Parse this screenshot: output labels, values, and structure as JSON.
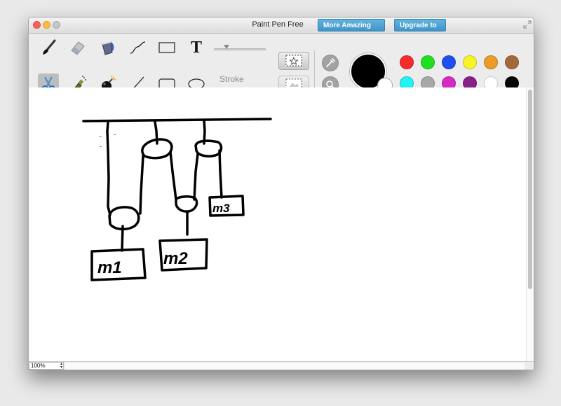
{
  "window": {
    "title": "Paint Pen Free",
    "more_apps_label": "More Amazing Apps",
    "upgrade_label": "Upgrade to Pro"
  },
  "toolbar": {
    "tools_row1": [
      "brush-icon",
      "eraser-icon",
      "paint-bucket-icon",
      "curve-icon",
      "rectangle-icon",
      "text-icon"
    ],
    "tools_row2": [
      "scissors-icon",
      "spray-icon",
      "bomb-icon",
      "line-icon",
      "rounded-rectangle-icon",
      "ellipse-icon"
    ],
    "selected_tool": "scissors-icon",
    "text_tool_glyph": "T",
    "stroke_label": "Stroke",
    "stroke_value": 0.2
  },
  "colors": {
    "current": "#000000",
    "background": "#ffffff",
    "palette_row1": [
      "#f52a2a",
      "#1fe01f",
      "#1f4ef0",
      "#f8f32b",
      "#ec9a2a",
      "#a4693a"
    ],
    "palette_row2": [
      "#22f3f3",
      "#a8a8a8",
      "#d42bc6",
      "#8a1f86",
      "#ffffff",
      "#050505"
    ]
  },
  "canvas": {
    "labels": [
      "m1",
      "m2",
      "m3"
    ]
  },
  "statusbar": {
    "zoom": "100%"
  }
}
